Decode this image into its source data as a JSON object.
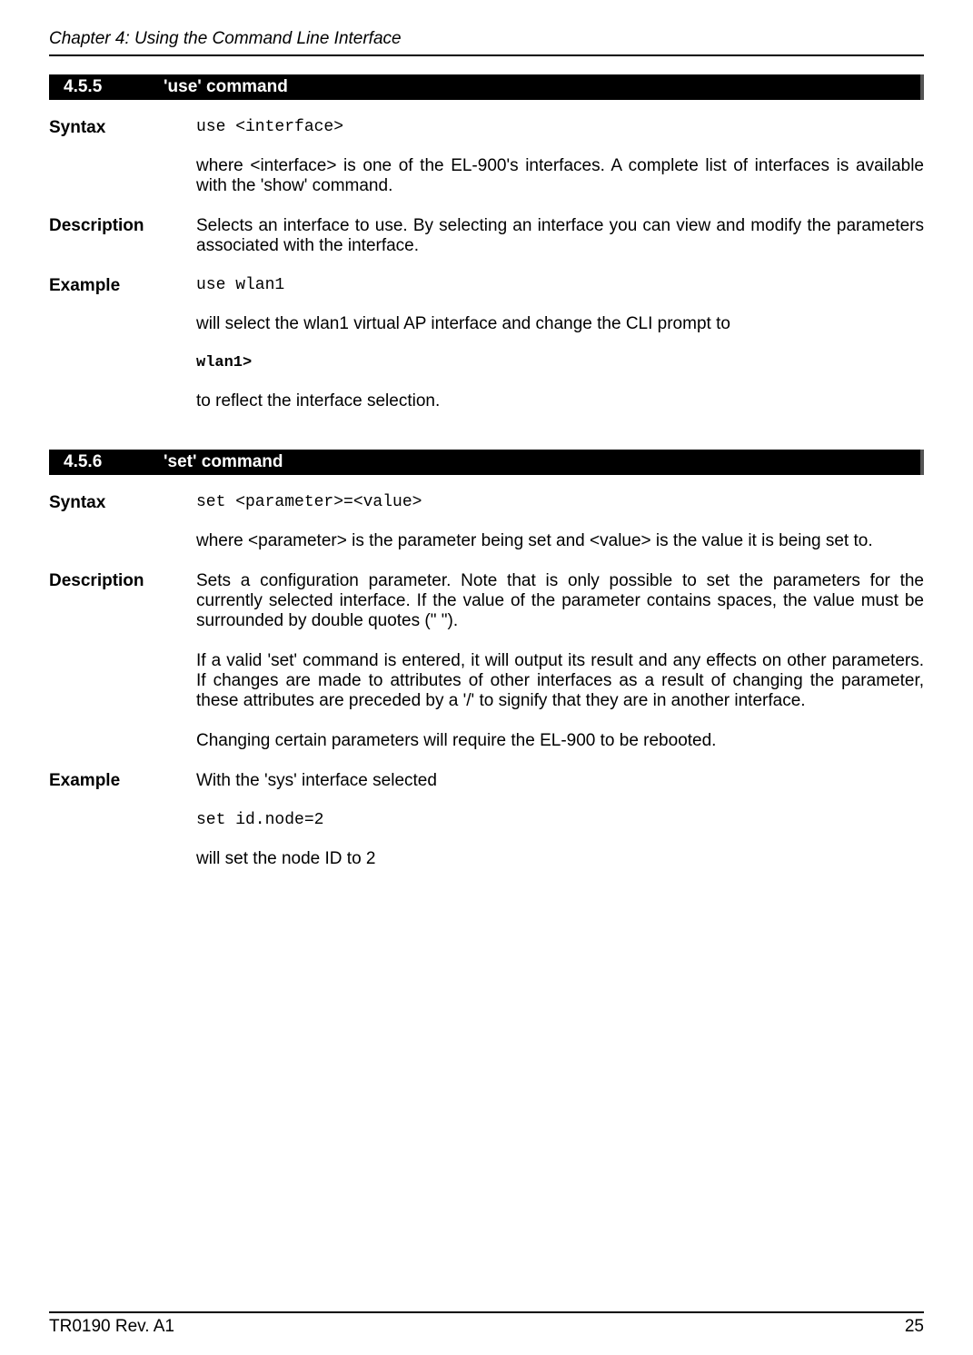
{
  "header": "Chapter 4: Using the Command Line Interface",
  "section455": {
    "num": "4.5.5",
    "title": "'use' command",
    "syntax_label": "Syntax",
    "syntax_code": "use <interface>",
    "syntax_note": "where <interface> is one of the EL-900's interfaces. A complete list of interfaces is available with the 'show' command.",
    "desc_label": "Description",
    "desc_text": "Selects an interface to use. By selecting an interface you can view and modify the parameters associated with the interface.",
    "example_label": "Example",
    "example_code": "use wlan1",
    "example_text1": "will select the wlan1 virtual AP interface and change the CLI prompt to",
    "example_prompt": "wlan1>",
    "example_text2": "to reflect the interface selection."
  },
  "section456": {
    "num": "4.5.6",
    "title": "'set' command",
    "syntax_label": "Syntax",
    "syntax_code": "set <parameter>=<value>",
    "syntax_note": "where <parameter> is the parameter being set and <value> is the value it is being set to.",
    "desc_label": "Description",
    "desc_p1": "Sets a configuration parameter. Note that is only possible to set the parameters for the currently selected interface. If the value of the parameter contains spaces, the value must be surrounded by double quotes (\" \").",
    "desc_p2": "If a valid 'set' command is entered, it will output its result and any effects on other parameters. If changes are made to attributes of other interfaces as a result of changing the parameter, these attributes are preceded by a '/' to signify that they are in another interface.",
    "desc_p3": "Changing certain parameters will require the EL-900 to be rebooted.",
    "example_label": "Example",
    "example_intro": "With the 'sys' interface selected",
    "example_code": "set id.node=2",
    "example_result": "will set the node ID to 2"
  },
  "footer": {
    "left": "TR0190 Rev. A1",
    "right": "25"
  }
}
